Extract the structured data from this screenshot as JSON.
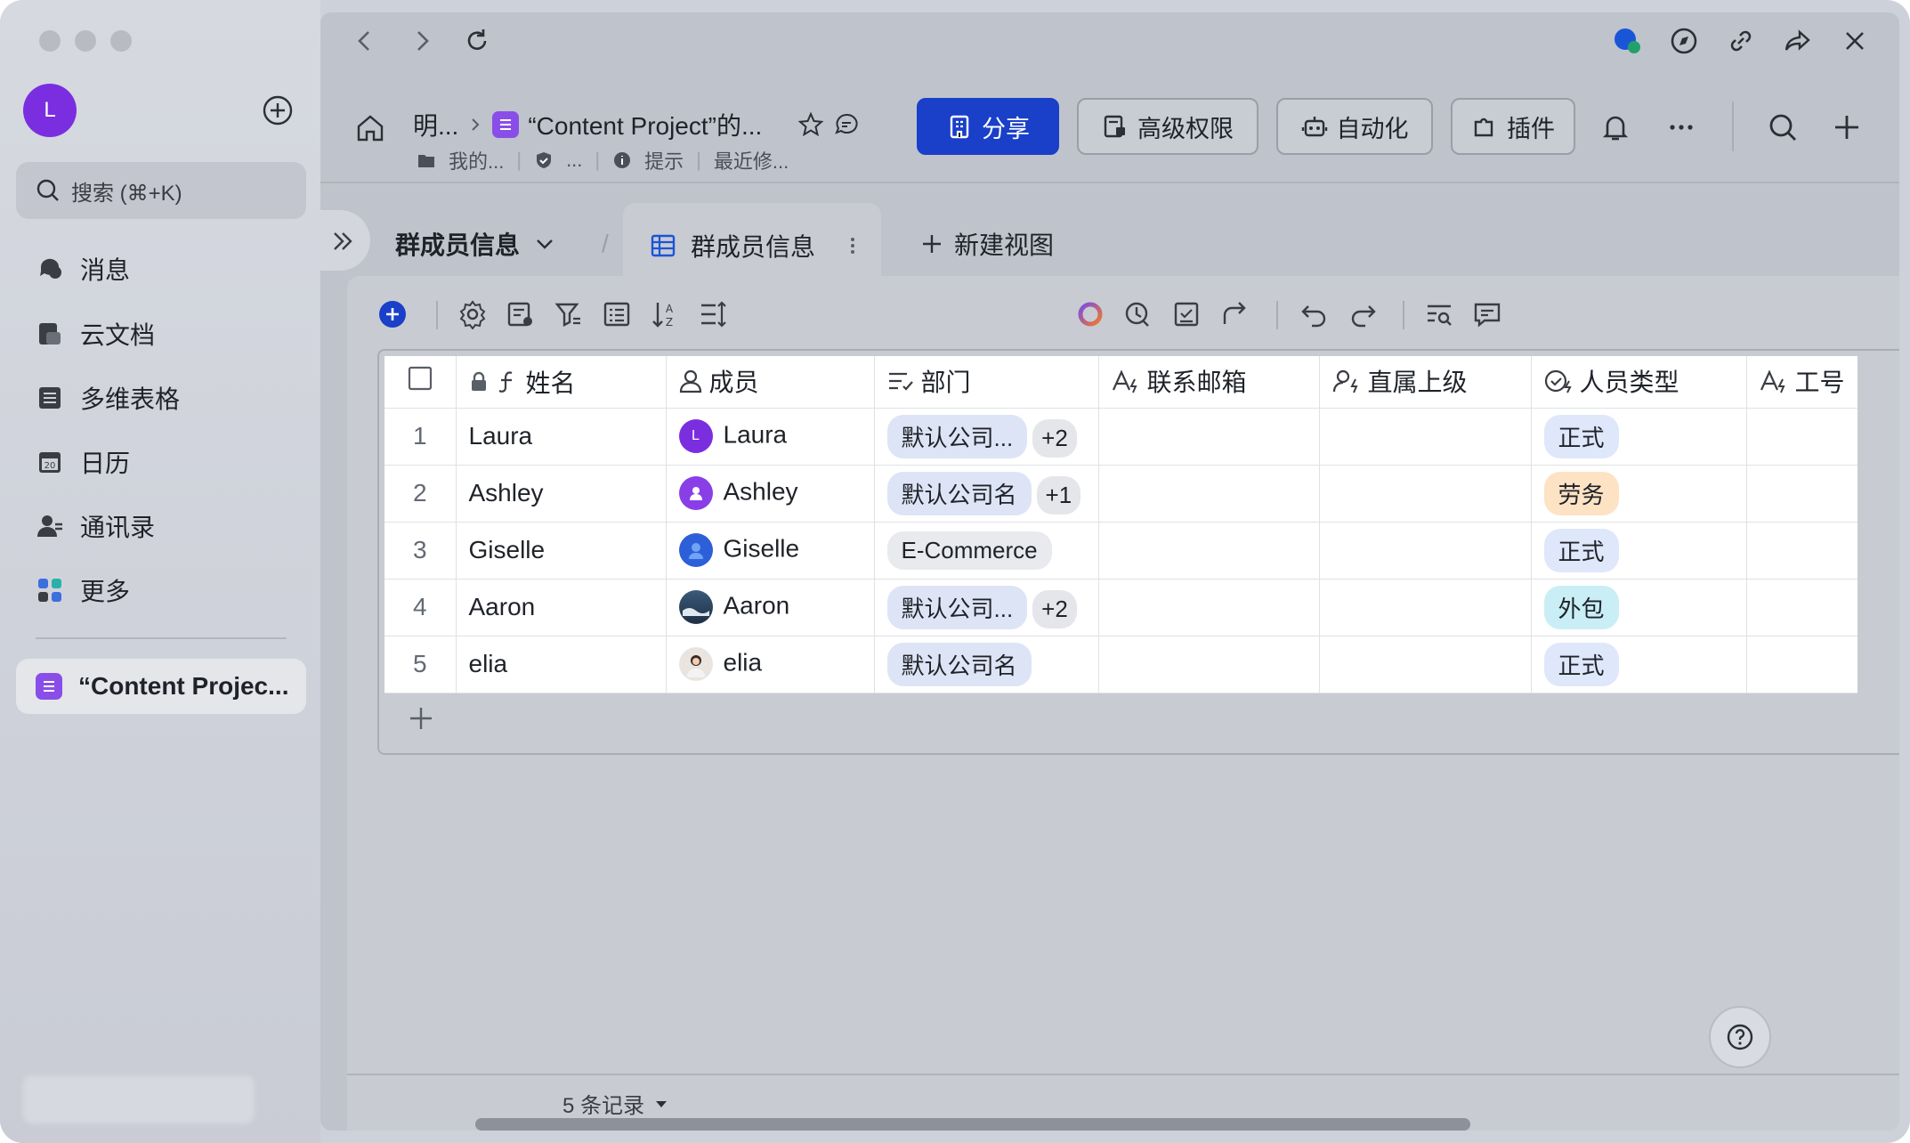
{
  "sidebar": {
    "avatar_letter": "L",
    "search_placeholder": "搜索 (⌘+K)",
    "items": [
      {
        "label": "消息",
        "icon": "chat-bubble-icon"
      },
      {
        "label": "云文档",
        "icon": "doc-icon"
      },
      {
        "label": "多维表格",
        "icon": "table-icon"
      },
      {
        "label": "日历",
        "icon": "calendar-icon",
        "day": "20"
      },
      {
        "label": "通讯录",
        "icon": "contacts-icon"
      },
      {
        "label": "更多",
        "icon": "apps-icon"
      }
    ],
    "current_doc": "“Content Projec..."
  },
  "header": {
    "crumb_root": "明...",
    "doc_title": "“Content Project”的...",
    "meta_owner": "我的...",
    "meta_verified": "...",
    "meta_hint": "提示",
    "meta_modified": "最近修...",
    "buttons": {
      "share": "分享",
      "permissions": "高级权限",
      "automation": "自动化",
      "plugins": "插件"
    }
  },
  "tabs": {
    "table_name": "群成员信息",
    "active_view": "群成员信息",
    "new_view": "新建视图"
  },
  "grid": {
    "columns": [
      "姓名",
      "成员",
      "部门",
      "联系邮箱",
      "直属上级",
      "人员类型",
      "工号"
    ],
    "rows": [
      {
        "num": "1",
        "name": "Laura",
        "member": "Laura",
        "avatar_letter": "L",
        "dept": "默认公司...",
        "dept_more": "+2",
        "type": "正式"
      },
      {
        "num": "2",
        "name": "Ashley",
        "member": "Ashley",
        "avatar_letter": "",
        "dept": "默认公司名",
        "dept_more": "+1",
        "type": "劳务"
      },
      {
        "num": "3",
        "name": "Giselle",
        "member": "Giselle",
        "avatar_letter": "",
        "dept": "E-Commerce",
        "dept_more": "",
        "type": "正式"
      },
      {
        "num": "4",
        "name": "Aaron",
        "member": "Aaron",
        "avatar_letter": "",
        "dept": "默认公司...",
        "dept_more": "+2",
        "type": "外包"
      },
      {
        "num": "5",
        "name": "elia",
        "member": "elia",
        "avatar_letter": "",
        "dept": "默认公司名",
        "dept_more": "",
        "type": "正式"
      }
    ]
  },
  "footer": {
    "record_count": "5 条记录"
  },
  "colors": {
    "primary": "#1a3fc9",
    "tag_fulltime": "#dfe7fb",
    "tag_labor": "#fde2c4",
    "tag_outsource": "#c9eef6"
  }
}
